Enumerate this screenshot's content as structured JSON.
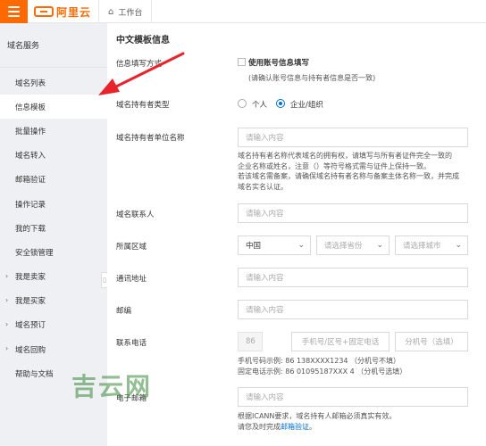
{
  "topbar": {
    "logo_text": "阿里云",
    "home_tab": "工作台",
    "colors": {
      "brand": "#ff6a00"
    }
  },
  "sidebar": {
    "header": "域名服务",
    "items": [
      {
        "label": "域名列表",
        "active": false,
        "group": false
      },
      {
        "label": "信息模板",
        "active": true,
        "group": false
      },
      {
        "label": "批量操作",
        "active": false,
        "group": false
      },
      {
        "label": "域名转入",
        "active": false,
        "group": false
      },
      {
        "label": "邮箱验证",
        "active": false,
        "group": false
      },
      {
        "label": "操作记录",
        "active": false,
        "group": false
      },
      {
        "label": "我的下载",
        "active": false,
        "group": false
      },
      {
        "label": "安全锁管理",
        "active": false,
        "group": false
      },
      {
        "label": "我是卖家",
        "active": false,
        "group": true
      },
      {
        "label": "我是买家",
        "active": false,
        "group": true
      },
      {
        "label": "域名预订",
        "active": false,
        "group": true
      },
      {
        "label": "域名回购",
        "active": false,
        "group": true
      },
      {
        "label": "帮助与文档",
        "active": false,
        "group": false
      }
    ]
  },
  "form": {
    "title": "中文模板信息",
    "fill_method": {
      "label": "信息填写方式",
      "checkbox_label": "使用账号信息填写",
      "note": "(请确认账号信息与持有者信息是否一致)"
    },
    "holder_type": {
      "label": "域名持有者类型",
      "options": [
        "个人",
        "企业/组织"
      ],
      "selected": "企业/组织"
    },
    "org_name": {
      "label": "域名持有者单位名称",
      "placeholder": "请输入内容",
      "hint_lines": [
        "域名持有者名称代表域名的拥有权，请填写与所有者证件完全一致的",
        "企业名称或姓名，注意（）等符号格式需与证件上保持一致。",
        "若该域名需备案，请确保域名持有者名称与备案主体名称一致，并完成",
        "域名实名认证。"
      ]
    },
    "contact": {
      "label": "域名联系人",
      "placeholder": "请输入内容"
    },
    "region": {
      "label": "所属区域",
      "country": "中国",
      "province_placeholder": "请选择省份",
      "city_placeholder": "请选择城市"
    },
    "address": {
      "label": "通讯地址",
      "placeholder": "请输入内容"
    },
    "postcode": {
      "label": "邮编",
      "placeholder": "请输入内容"
    },
    "phone": {
      "label": "联系电话",
      "country_code": "86",
      "number_placeholder": "手机号/区号+固定电话",
      "ext_placeholder": "分机号（选填）",
      "example_mobile": "手机号码示例: 86 138XXXX1234  （分机号不填）",
      "example_landline": "固定电话示例: 86 01095187XXX 4 （分机号选填）"
    },
    "email": {
      "label": "电子邮箱",
      "placeholder": "请输入内容",
      "hint_line1": "根据ICANN要求，域名持有人邮箱必须真实有效。",
      "hint_line2_prefix": "请您及时完成",
      "hint_link": "邮箱验证",
      "hint_line2_suffix": "。"
    }
  },
  "watermark": "吉云网"
}
